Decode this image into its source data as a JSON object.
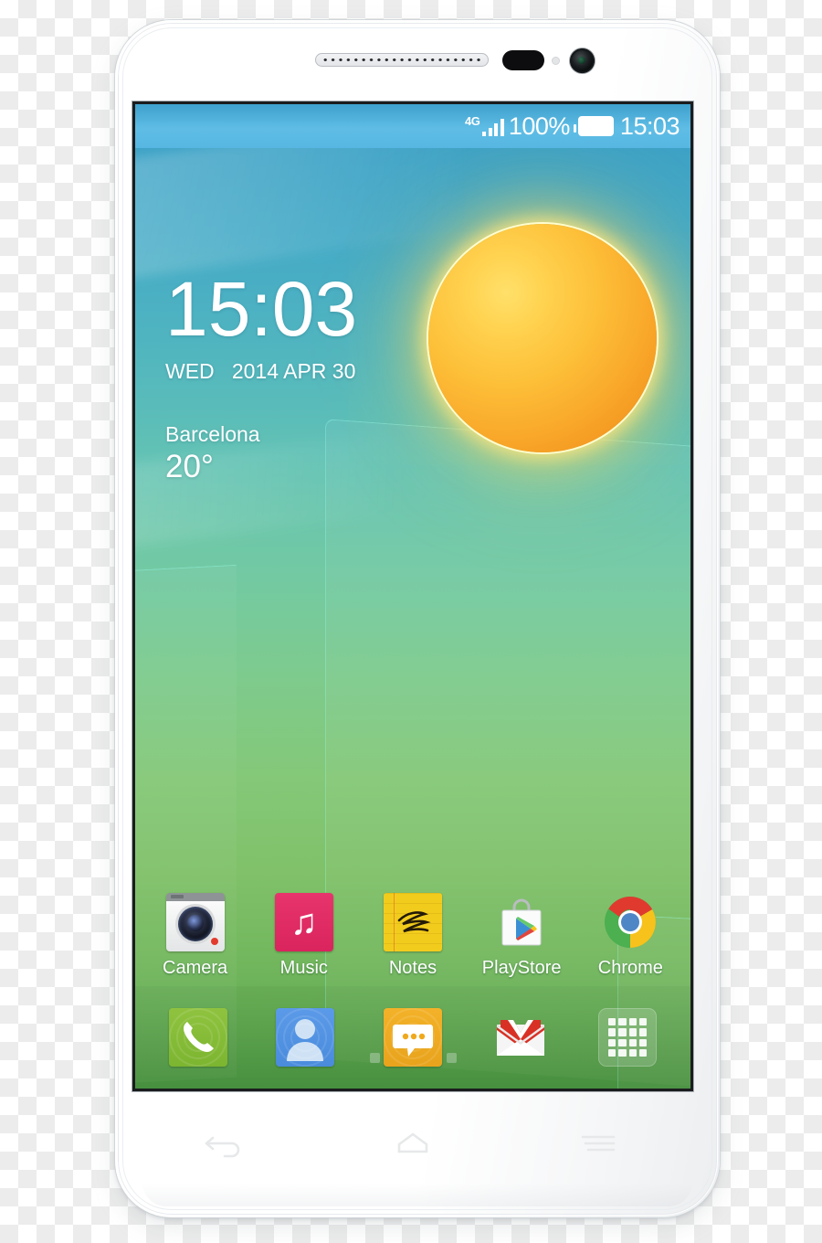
{
  "device": {
    "hardware": {
      "earpiece": "earpiece-speaker",
      "proximity_sensor": "proximity-sensor",
      "light_sensor": "light-sensor",
      "front_camera": "front-camera"
    },
    "nav_buttons": [
      {
        "name": "back-button",
        "icon": "back-arrow-icon"
      },
      {
        "name": "home-button",
        "icon": "home-icon"
      },
      {
        "name": "menu-button",
        "icon": "menu-lines-icon"
      }
    ]
  },
  "status_bar": {
    "network_type": "4G",
    "signal_icon": "signal-bars-icon",
    "battery_percent": "100%",
    "battery_icon": "battery-full-icon",
    "clock": "15:03"
  },
  "widget": {
    "time": "15:03",
    "date": "WED   2014 APR 30",
    "city": "Barcelona",
    "temperature": "20°",
    "weather_icon": "sun-icon"
  },
  "home_screen": {
    "apps": [
      {
        "label": "Camera",
        "icon": "camera-icon"
      },
      {
        "label": "Music",
        "icon": "music-note-icon"
      },
      {
        "label": "Notes",
        "icon": "notes-icon"
      },
      {
        "label": "PlayStore",
        "icon": "play-store-icon"
      },
      {
        "label": "Chrome",
        "icon": "chrome-icon"
      }
    ],
    "page_indicator": {
      "total": 5,
      "active": 3
    },
    "dock": [
      {
        "name": "phone",
        "icon": "phone-handset-icon"
      },
      {
        "name": "contacts",
        "icon": "person-icon"
      },
      {
        "name": "messages",
        "icon": "speech-bubble-icon"
      },
      {
        "name": "gmail",
        "icon": "gmail-envelope-icon"
      },
      {
        "name": "app-drawer",
        "icon": "grid-icon"
      }
    ]
  },
  "colors": {
    "status_bar_blue": "#5fbde5",
    "sky_blue": "#3da2c6",
    "grass_green": "#4f9c45",
    "sun_orange": "#f9a82a",
    "music_pink": "#e8346d",
    "notes_yellow": "#f2cc1d",
    "phone_green": "#8fc33f",
    "contacts_blue": "#5b9ae8",
    "messages_orange": "#f3b229",
    "gmail_red": "#d93025"
  }
}
